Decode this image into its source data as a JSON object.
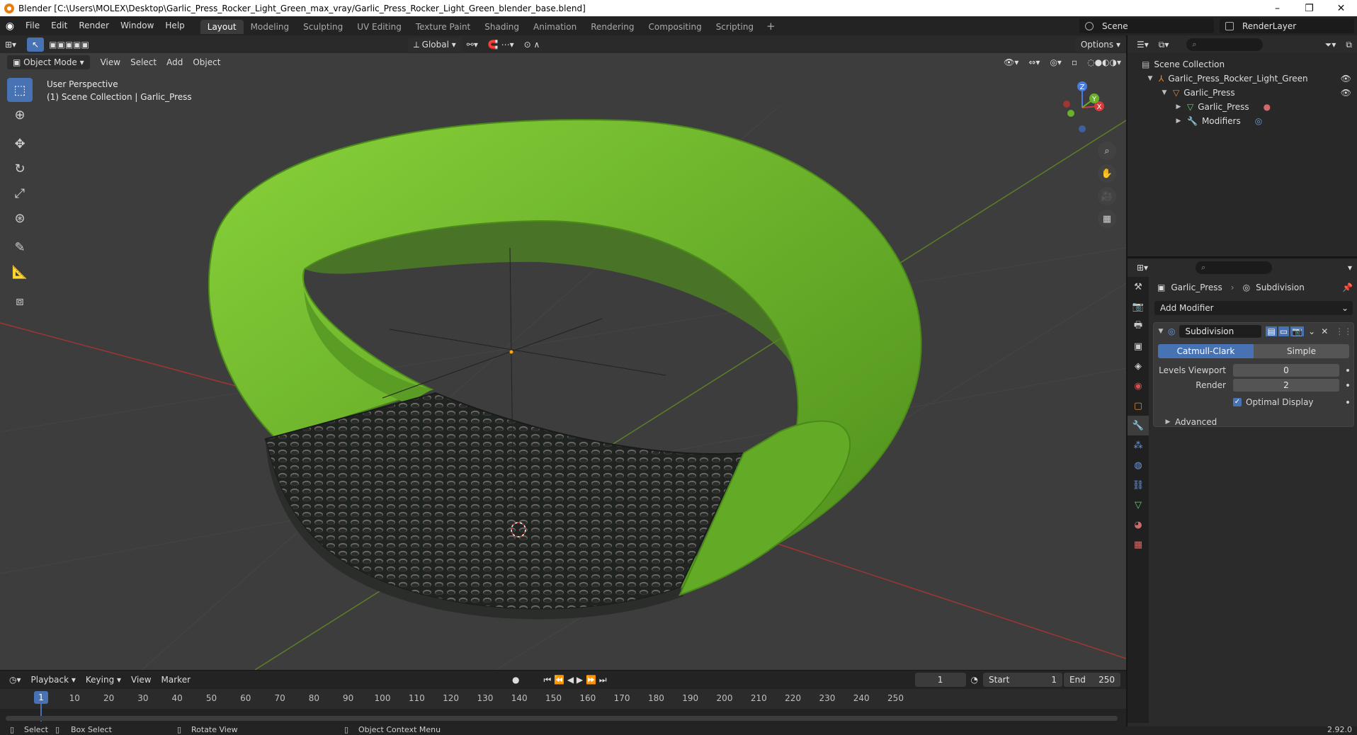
{
  "window": {
    "title": "Blender [C:\\Users\\MOLEX\\Desktop\\Garlic_Press_Rocker_Light_Green_max_vray/Garlic_Press_Rocker_Light_Green_blender_base.blend]",
    "minimize": "–",
    "restore": "❐",
    "close": "✕"
  },
  "menus": [
    "File",
    "Edit",
    "Render",
    "Window",
    "Help"
  ],
  "workspaces": [
    {
      "label": "Layout",
      "active": true
    },
    {
      "label": "Modeling"
    },
    {
      "label": "Sculpting"
    },
    {
      "label": "UV Editing"
    },
    {
      "label": "Texture Paint"
    },
    {
      "label": "Shading"
    },
    {
      "label": "Animation"
    },
    {
      "label": "Rendering"
    },
    {
      "label": "Compositing"
    },
    {
      "label": "Scripting"
    }
  ],
  "workspace_add": "+",
  "scene": "Scene",
  "render_layer": "RenderLayer",
  "viewport": {
    "transform_orientation": "Global",
    "options": "Options",
    "mode": "Object Mode",
    "menu": [
      "View",
      "Select",
      "Add",
      "Object"
    ],
    "perspective": "User Perspective",
    "collection_info": "(1) Scene Collection | Garlic_Press",
    "gizmo": {
      "x": "X",
      "y": "Y",
      "z": "Z"
    },
    "colors": {
      "bg": "#3d3d3d",
      "object_green": "#6cb42a",
      "grid_red": "#b03a3a",
      "grid_green": "#6a8f2a"
    }
  },
  "timeline": {
    "menus": [
      "Playback",
      "Keying",
      "View",
      "Marker"
    ],
    "current_frame": "1",
    "start_label": "Start",
    "start": "1",
    "end_label": "End",
    "end": "250",
    "ticks": [
      "1",
      "10",
      "20",
      "30",
      "40",
      "50",
      "60",
      "70",
      "80",
      "90",
      "100",
      "110",
      "120",
      "130",
      "140",
      "150",
      "160",
      "170",
      "180",
      "190",
      "200",
      "210",
      "220",
      "230",
      "240",
      "250"
    ]
  },
  "statusbar": {
    "select": "Select",
    "box_select": "Box Select",
    "rotate_view": "Rotate View",
    "context_menu": "Object Context Menu",
    "version": "2.92.0"
  },
  "outliner": {
    "search_placeholder": "",
    "root": "Scene Collection",
    "items": [
      {
        "label": "Garlic_Press_Rocker_Light_Green"
      },
      {
        "label": "Garlic_Press"
      },
      {
        "label": "Garlic_Press"
      },
      {
        "label": "Modifiers"
      }
    ]
  },
  "properties": {
    "search_placeholder": "",
    "object_name": "Garlic_Press",
    "modifier_crumb": "Subdivision",
    "add_modifier": "Add Modifier",
    "modifier": {
      "name": "Subdivision",
      "type_on": "Catmull-Clark",
      "type_off": "Simple",
      "levels_viewport_label": "Levels Viewport",
      "levels_viewport": "0",
      "render_label": "Render",
      "render": "2",
      "optimal_display_label": "Optimal Display",
      "advanced_label": "Advanced"
    }
  }
}
